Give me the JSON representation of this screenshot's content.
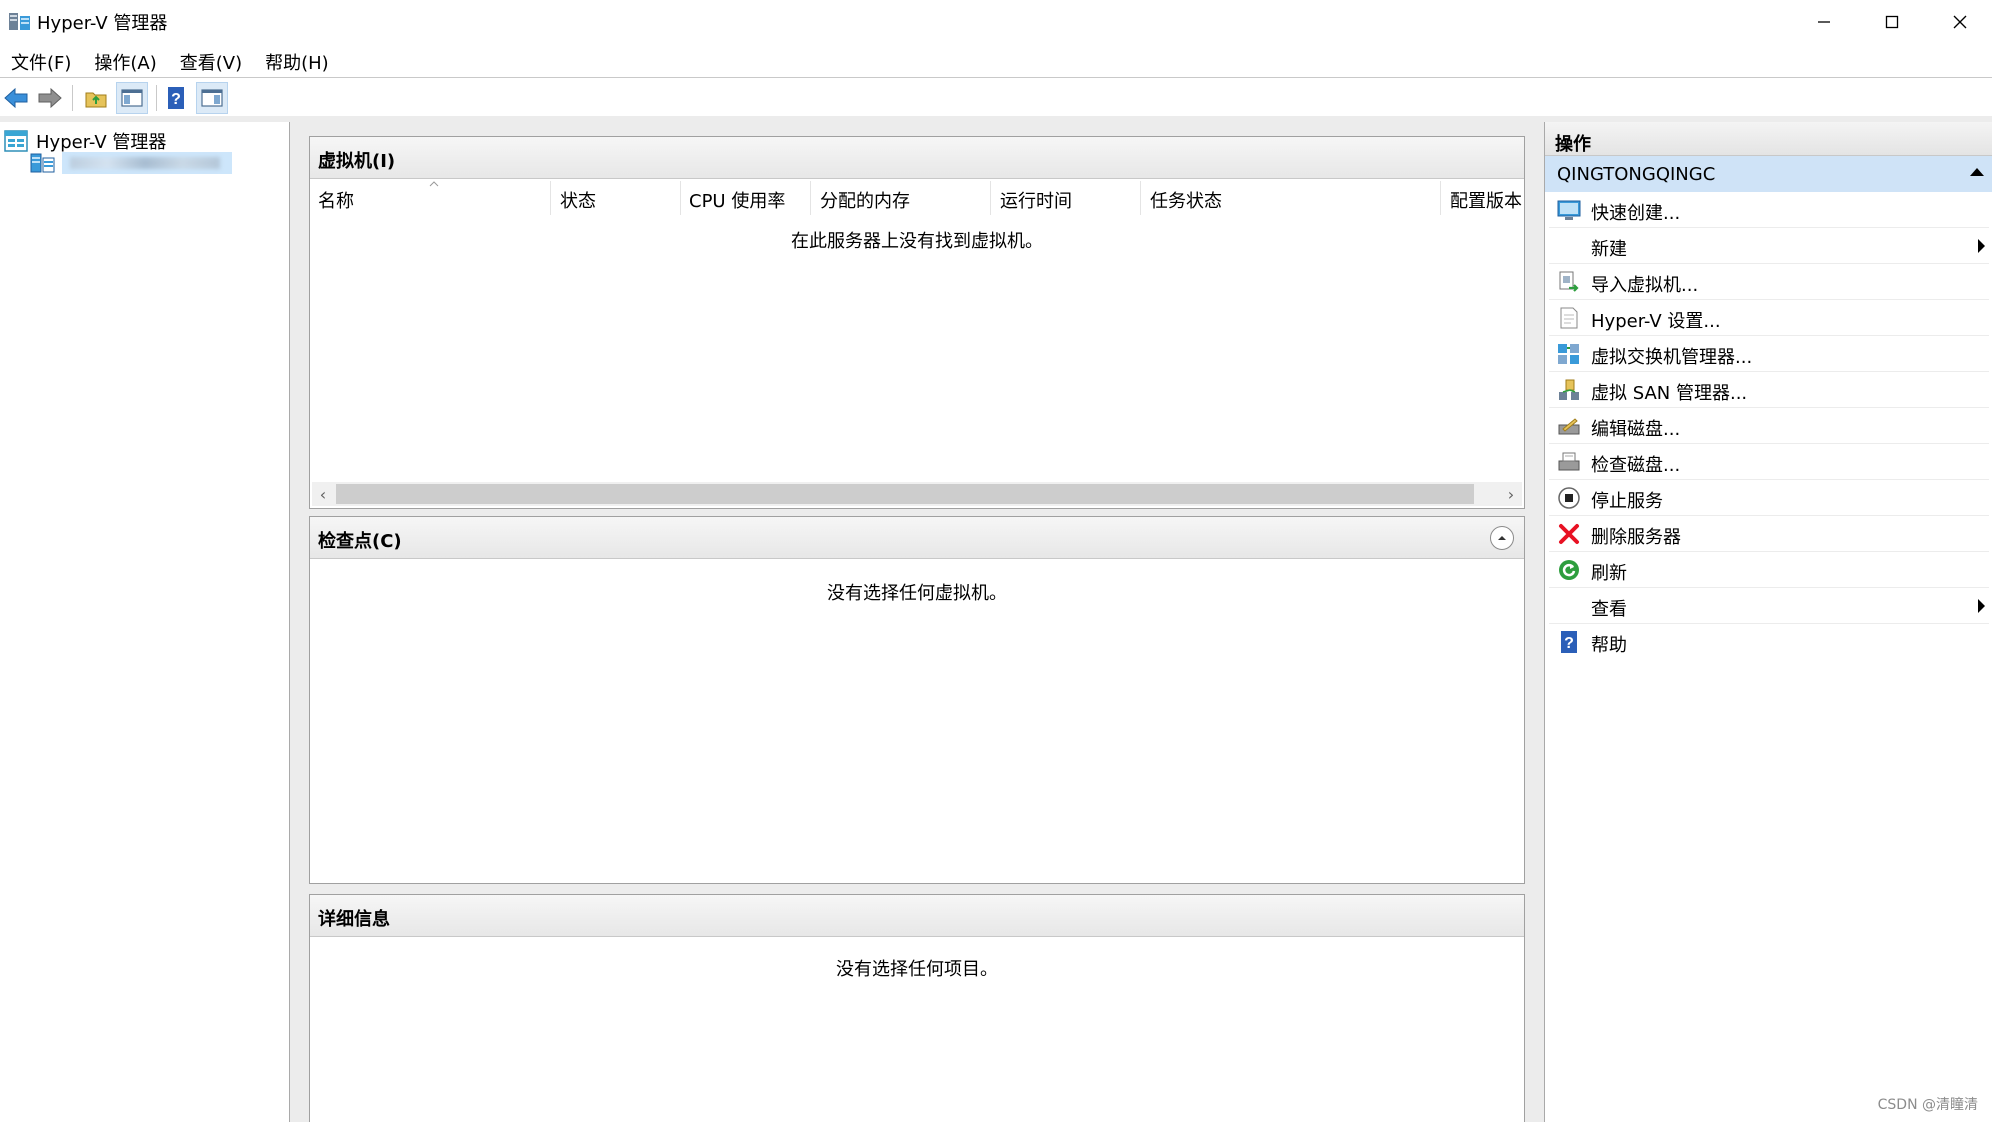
{
  "window": {
    "title": "Hyper-V 管理器",
    "minimize_icon": "minimize-icon",
    "maximize_icon": "maximize-icon",
    "close_icon": "close-icon"
  },
  "menu": {
    "items": [
      {
        "label": "文件(F)"
      },
      {
        "label": "操作(A)"
      },
      {
        "label": "查看(V)"
      },
      {
        "label": "帮助(H)"
      }
    ]
  },
  "toolbar": {
    "icons": [
      "back-arrow-icon",
      "forward-arrow-icon",
      "up-folder-icon",
      "show-hide-console-tree-icon",
      "help-icon",
      "show-hide-action-pane-icon"
    ]
  },
  "tree": {
    "root_label": "Hyper-V 管理器",
    "child_label": ""
  },
  "vm_panel": {
    "title": "虚拟机(I)",
    "columns": [
      "名称",
      "状态",
      "CPU 使用率",
      "分配的内存",
      "运行时间",
      "任务状态",
      "配置版本"
    ],
    "empty_message": "在此服务器上没有找到虚拟机。"
  },
  "checkpoint_panel": {
    "title": "检查点(C)",
    "empty_message": "没有选择任何虚拟机。"
  },
  "details_panel": {
    "title": "详细信息",
    "empty_message": "没有选择任何项目。"
  },
  "actions": {
    "header": "操作",
    "group_label": "QINGTONGQINGC",
    "items": [
      {
        "label": "快速创建...",
        "icon": "quick-create-icon"
      },
      {
        "label": "新建",
        "icon": "",
        "submenu": true
      },
      {
        "label": "导入虚拟机...",
        "icon": "import-vm-icon"
      },
      {
        "label": "Hyper-V 设置...",
        "icon": "settings-doc-icon"
      },
      {
        "label": "虚拟交换机管理器...",
        "icon": "virtual-switch-icon"
      },
      {
        "label": "虚拟 SAN 管理器...",
        "icon": "virtual-san-icon"
      },
      {
        "label": "编辑磁盘...",
        "icon": "edit-disk-icon"
      },
      {
        "label": "检查磁盘...",
        "icon": "inspect-disk-icon"
      },
      {
        "label": "停止服务",
        "icon": "stop-service-icon"
      },
      {
        "label": "删除服务器",
        "icon": "delete-red-x-icon"
      },
      {
        "label": "刷新",
        "icon": "refresh-green-icon"
      },
      {
        "label": "查看",
        "icon": "",
        "submenu": true
      },
      {
        "label": "帮助",
        "icon": "help-icon"
      }
    ]
  },
  "watermark": "CSDN @清瞳清",
  "colors": {
    "selection_blue": "#cfe3f7",
    "delete_red": "#e81123",
    "refresh_green": "#2e9e3e",
    "help_blue": "#2b5fb8"
  }
}
